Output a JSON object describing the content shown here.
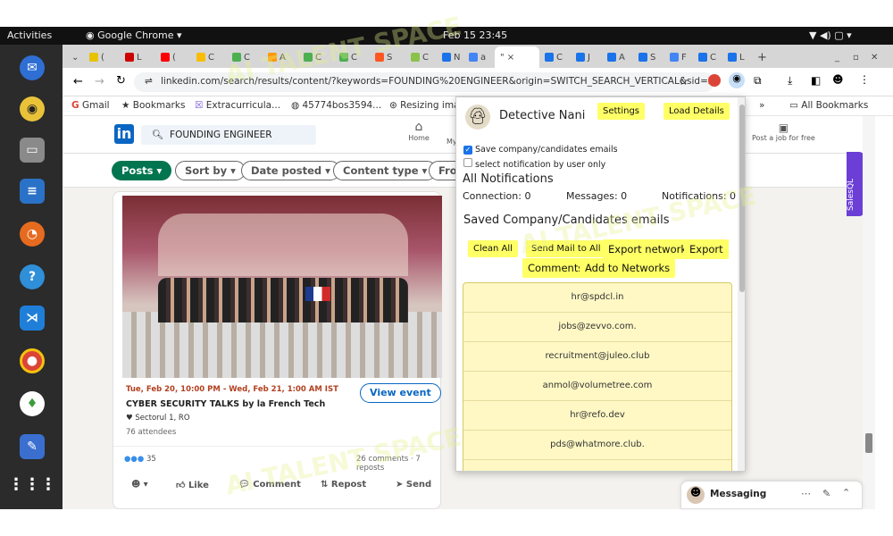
{
  "topbar": {
    "activities": "Activities",
    "app_name": "Google Chrome",
    "clock": "Feb 15  23:45"
  },
  "chrome": {
    "url": "linkedin.com/search/results/content/?keywords=FOUNDING%20ENGINEER&origin=SWITCH_SEARCH_VERTICAL&sid=XC6",
    "active_tab_label": "\"",
    "bookmarks": [
      "Gmail",
      "Bookmarks",
      "Extracurricula...",
      "45774bos3594...",
      "Resizing ima"
    ],
    "all_bookmarks": "All Bookmarks"
  },
  "linkedin": {
    "logo": "in",
    "search_value": "FOUNDING ENGINEER",
    "nav_home": "Home",
    "nav_partial": "My",
    "post_job": "Post a job for free",
    "filters": {
      "posts": "Posts",
      "sort_by": "Sort by",
      "date_posted": "Date posted",
      "content_type": "Content type",
      "from": "Fro"
    },
    "event": {
      "date": "Tue, Feb 20, 10:00 PM - Wed, Feb 21, 1:00 AM IST",
      "title": "CYBER SECURITY TALKS by la French Tech",
      "location": "Sectorul 1, RO",
      "attendees": "76 attendees",
      "view_button": "View event"
    },
    "reactions_count": "35",
    "comments_reposts": "26 comments · 7 reposts",
    "actions": {
      "like": "Like",
      "comment": "Comment",
      "repost": "Repost",
      "send": "Send"
    },
    "messaging": "Messaging"
  },
  "salesql_tab": "SalesQL",
  "popup": {
    "title": "Detective Nani",
    "settings": "Settings",
    "load_details": "Load Details",
    "save_checkbox_label": "Save company/candidates emails",
    "notify_checkbox_label": "select notification by user only",
    "all_notifications": "All Notifications",
    "connection": "Connection: 0",
    "messages": "Messages: 0",
    "notifications": "Notifications: 0",
    "saved_heading": "Saved Company/Candidates emails",
    "buttons": {
      "clean_all": "Clean All",
      "send_mail": "Send Mail to All",
      "export_network": "Export network",
      "export_comments_1": "Export",
      "export_comments_2": "Comments",
      "add_networks": "Add to Networks"
    },
    "emails": [
      "hr@spdcl.in",
      "jobs@zevvo.com.",
      "recruitment@juleo.club",
      "anmol@volumetree.com",
      "hr@refo.dev",
      "pds@whatmore.club."
    ]
  },
  "colors": {
    "linkedin_blue": "#0a66c2",
    "posts_green": "#01754f",
    "highlight_yellow": "#ffff66",
    "email_bg": "#fff8c4"
  },
  "watermark": "AI TALENT SPACE"
}
